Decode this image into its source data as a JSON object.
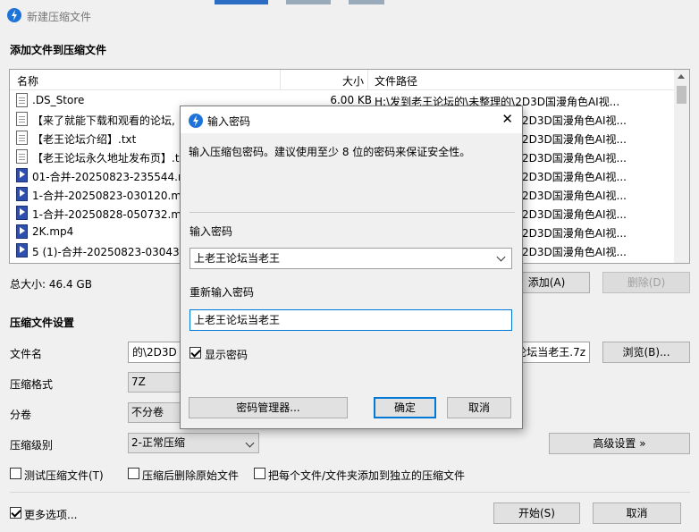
{
  "window": {
    "title": "新建压缩文件"
  },
  "files_section": {
    "title": "添加文件到压缩文件",
    "columns": {
      "name": "名称",
      "size": "大小",
      "path": "文件路径"
    },
    "rows": [
      {
        "icon": "document-icon",
        "name": ".DS_Store",
        "size": "6.00 KB",
        "path": "H:\\发到老王论坛的\\未整理的\\2D3D国漫角色AI视..."
      },
      {
        "icon": "document-icon",
        "name": "【来了就能下载和观看的论坛,",
        "size": "",
        "path": "2D3D国漫角色AI视..."
      },
      {
        "icon": "document-icon",
        "name": "【老王论坛介绍】.txt",
        "size": "",
        "path": "2D3D国漫角色AI视..."
      },
      {
        "icon": "document-icon",
        "name": "【老王论坛永久地址发布页】.t",
        "size": "",
        "path": "2D3D国漫角色AI视..."
      },
      {
        "icon": "mp4-icon",
        "name": "01-合并-20250823-235544.m",
        "size": "",
        "path": "2D3D国漫角色AI视..."
      },
      {
        "icon": "mp4-icon",
        "name": "1-合并-20250823-030120.mp",
        "size": "",
        "path": "2D3D国漫角色AI视..."
      },
      {
        "icon": "mp4-icon",
        "name": "1-合并-20250828-050732.mp",
        "size": "",
        "path": "2D3D国漫角色AI视..."
      },
      {
        "icon": "mp4-icon",
        "name": "2K.mp4",
        "size": "",
        "path": "2D3D国漫角色AI视..."
      },
      {
        "icon": "mp4-icon",
        "name": "5 (1)-合并-20250823-030438.",
        "size": "",
        "path": "2D3D国漫角色AI视..."
      }
    ],
    "total_size": "总大小: 46.4 GB",
    "add_button": "添加(A)",
    "delete_button": "删除(D)"
  },
  "settings": {
    "title": "压缩文件设置",
    "filename_label": "文件名",
    "filename_prefix": "的\\2D3D",
    "filename_suffix": "论坛当老王.7z",
    "browse_button": "浏览(B)...",
    "format_label": "压缩格式",
    "format_value": "7Z",
    "split_label": "分卷",
    "split_value": "不分卷",
    "level_label": "压缩级别",
    "level_value": "2-正常压缩",
    "advanced_button": "高级设置 »",
    "test_checkbox": "测试压缩文件(T)",
    "delete_checkbox": "压缩后删除原始文件",
    "each_checkbox": "把每个文件/文件夹添加到独立的压缩文件",
    "more_options": "更多选项...",
    "start_button": "开始(S)",
    "cancel_button": "取消"
  },
  "dialog": {
    "title": "输入密码",
    "description": "输入压缩包密码。建议使用至少 8 位的密码来保证安全性。",
    "password_label": "输入密码",
    "password_value": "上老王论坛当老王",
    "confirm_label": "重新输入密码",
    "confirm_value": "上老王论坛当老王",
    "show_password": "显示密码",
    "show_password_checked": true,
    "manager_button": "密码管理器...",
    "ok_button": "确定",
    "cancel_button": "取消",
    "close_symbol": "✕"
  }
}
